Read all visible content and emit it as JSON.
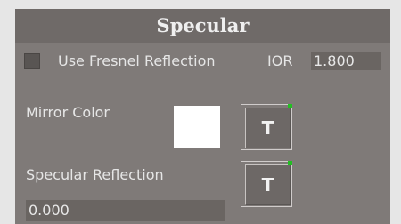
{
  "panel": {
    "title": "Specular",
    "fresnel": {
      "label": "Use Fresnel Reflection",
      "checked": false
    },
    "ior": {
      "label": "IOR",
      "value": "1.800"
    },
    "mirror_color": {
      "label": "Mirror Color",
      "color": "#ffffff",
      "texture_button": "T"
    },
    "specular_reflection": {
      "label": "Specular Reflection",
      "value": "0.000",
      "texture_button": "T"
    }
  },
  "colors": {
    "panel_bg": "#7f7a78",
    "header_bg": "#6f6a68",
    "field_bg": "#6a6562",
    "texture_indicator": "#22c022"
  }
}
